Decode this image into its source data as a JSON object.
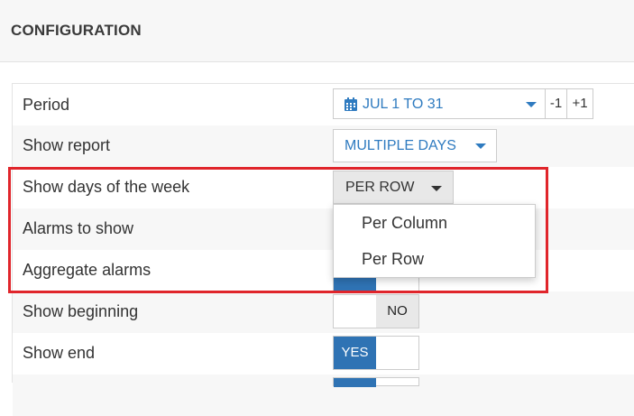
{
  "header": {
    "title": "CONFIGURATION"
  },
  "rows": [
    {
      "label": "Period"
    },
    {
      "label": "Show report"
    },
    {
      "label": "Show days of the week"
    },
    {
      "label": "Alarms to show"
    },
    {
      "label": "Aggregate alarms"
    },
    {
      "label": "Show beginning"
    },
    {
      "label": "Show end"
    }
  ],
  "period": {
    "value": "JUL 1 TO 31",
    "icon": "calendar-icon",
    "minus_label": "-1",
    "plus_label": "+1"
  },
  "show_report": {
    "value": "MULTIPLE DAYS"
  },
  "days_of_week": {
    "value": "PER ROW",
    "options": [
      "Per Column",
      "Per Row"
    ]
  },
  "show_beginning": {
    "no_label": "NO"
  },
  "show_end": {
    "yes_label": "YES"
  },
  "colors": {
    "accent": "#2f7bc0",
    "toggle_on": "#2f73b4",
    "highlight": "#e0252b"
  }
}
